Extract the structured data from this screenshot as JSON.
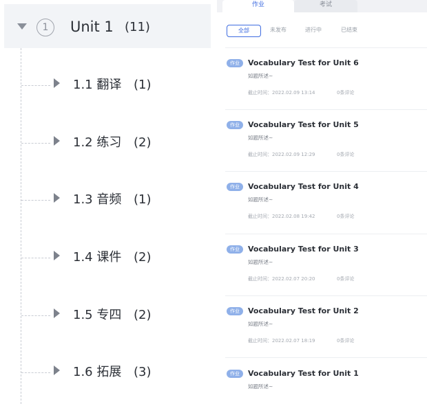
{
  "tree": {
    "unit": {
      "caret": "caret-down-icon",
      "index": "1",
      "title": "Unit 1",
      "count": "(11)"
    },
    "items": [
      {
        "label": "1.1 翻译",
        "count": "(1)"
      },
      {
        "label": "1.2 练习",
        "count": "(2)"
      },
      {
        "label": "1.3 音频",
        "count": "(1)"
      },
      {
        "label": "1.4 课件",
        "count": "(2)"
      },
      {
        "label": "1.5 专四",
        "count": "(2)"
      },
      {
        "label": "1.6 拓展",
        "count": "(3)"
      }
    ]
  },
  "panel": {
    "tabs": [
      {
        "label": "作业",
        "active": true
      },
      {
        "label": "考试",
        "active": false
      }
    ],
    "filters": [
      {
        "label": "全部",
        "active": true
      },
      {
        "label": "未发布",
        "active": false
      },
      {
        "label": "进行中",
        "active": false
      },
      {
        "label": "已结束",
        "active": false
      }
    ],
    "list": [
      {
        "tag": "作业",
        "title": "Vocabulary Test for Unit 6",
        "desc": "如题所述~",
        "deadline": "截止时间：2022.02.09 13:14",
        "comments": "0条评论"
      },
      {
        "tag": "作业",
        "title": "Vocabulary Test for Unit 5",
        "desc": "如题所述~",
        "deadline": "截止时间：2022.02.09 12:29",
        "comments": "0条评论"
      },
      {
        "tag": "作业",
        "title": "Vocabulary Test for Unit 4",
        "desc": "如题所述~",
        "deadline": "截止时间：2022.02.08 19:42",
        "comments": "0条评论"
      },
      {
        "tag": "作业",
        "title": "Vocabulary Test for Unit 3",
        "desc": "如题所述~",
        "deadline": "截止时间：2022.02.07 20:20",
        "comments": "0条评论"
      },
      {
        "tag": "作业",
        "title": "Vocabulary Test for Unit 2",
        "desc": "如题所述~",
        "deadline": "截止时间：2022.02.07 18:19",
        "comments": "0条评论"
      },
      {
        "tag": "作业",
        "title": "Vocabulary Test for Unit 1",
        "desc": "如题所述~",
        "deadline": "",
        "comments": ""
      }
    ]
  },
  "colors": {
    "accent": "#3d6be0",
    "tag": "#8fb0e9",
    "selected_row": "#f2f4f7"
  }
}
